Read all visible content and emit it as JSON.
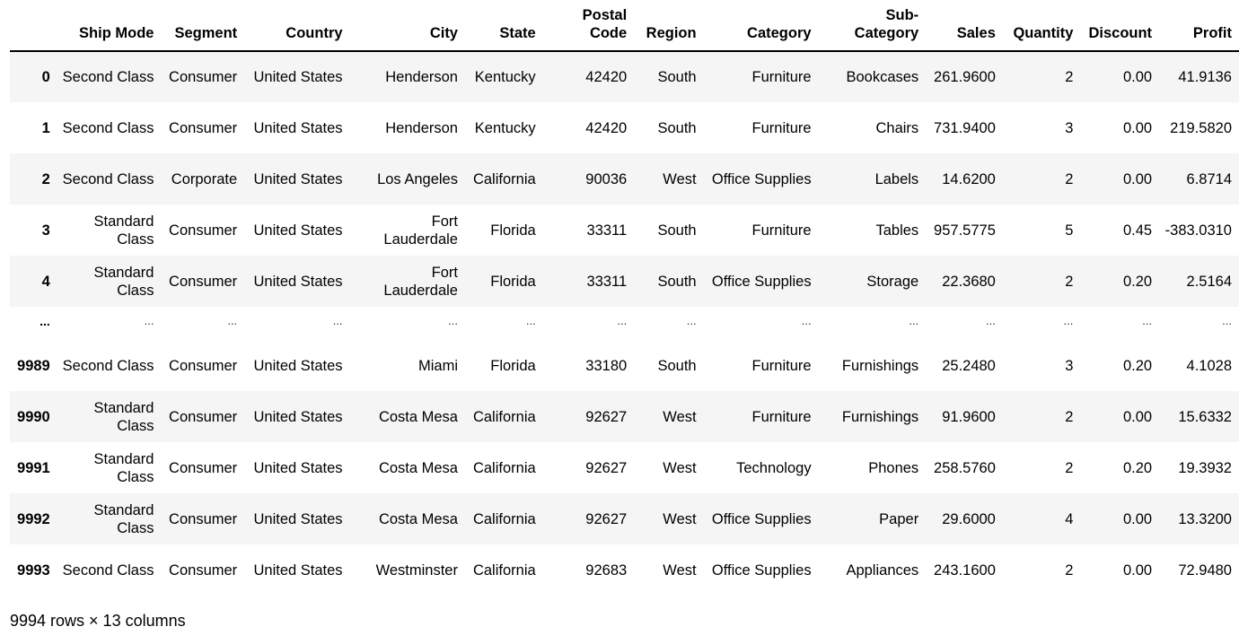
{
  "table": {
    "columns": [
      "",
      "Ship Mode",
      "Segment",
      "Country",
      "City",
      "State",
      "Postal Code",
      "Region",
      "Category",
      "Sub-Category",
      "Sales",
      "Quantity",
      "Discount",
      "Profit"
    ],
    "header_display": [
      "",
      "Ship Mode",
      "Segment",
      "Country",
      "City",
      "State",
      "Postal\nCode",
      "Region",
      "Category",
      "Sub-\nCategory",
      "Sales",
      "Quantity",
      "Discount",
      "Profit"
    ],
    "rows": [
      {
        "index": "0",
        "cells": [
          "Second Class",
          "Consumer",
          "United States",
          "Henderson",
          "Kentucky",
          "42420",
          "South",
          "Furniture",
          "Bookcases",
          "261.9600",
          "2",
          "0.00",
          "41.9136"
        ]
      },
      {
        "index": "1",
        "cells": [
          "Second Class",
          "Consumer",
          "United States",
          "Henderson",
          "Kentucky",
          "42420",
          "South",
          "Furniture",
          "Chairs",
          "731.9400",
          "3",
          "0.00",
          "219.5820"
        ]
      },
      {
        "index": "2",
        "cells": [
          "Second Class",
          "Corporate",
          "United States",
          "Los Angeles",
          "California",
          "90036",
          "West",
          "Office Supplies",
          "Labels",
          "14.6200",
          "2",
          "0.00",
          "6.8714"
        ]
      },
      {
        "index": "3",
        "cells": [
          "Standard Class",
          "Consumer",
          "United States",
          "Fort Lauderdale",
          "Florida",
          "33311",
          "South",
          "Furniture",
          "Tables",
          "957.5775",
          "5",
          "0.45",
          "-383.0310"
        ]
      },
      {
        "index": "4",
        "cells": [
          "Standard Class",
          "Consumer",
          "United States",
          "Fort Lauderdale",
          "Florida",
          "33311",
          "South",
          "Office Supplies",
          "Storage",
          "22.3680",
          "2",
          "0.20",
          "2.5164"
        ]
      },
      {
        "index": "...",
        "ellipsis": true,
        "cells": [
          "...",
          "...",
          "...",
          "...",
          "...",
          "...",
          "...",
          "...",
          "...",
          "...",
          "...",
          "...",
          "..."
        ]
      },
      {
        "index": "9989",
        "cells": [
          "Second Class",
          "Consumer",
          "United States",
          "Miami",
          "Florida",
          "33180",
          "South",
          "Furniture",
          "Furnishings",
          "25.2480",
          "3",
          "0.20",
          "4.1028"
        ]
      },
      {
        "index": "9990",
        "cells": [
          "Standard Class",
          "Consumer",
          "United States",
          "Costa Mesa",
          "California",
          "92627",
          "West",
          "Furniture",
          "Furnishings",
          "91.9600",
          "2",
          "0.00",
          "15.6332"
        ]
      },
      {
        "index": "9991",
        "cells": [
          "Standard Class",
          "Consumer",
          "United States",
          "Costa Mesa",
          "California",
          "92627",
          "West",
          "Technology",
          "Phones",
          "258.5760",
          "2",
          "0.20",
          "19.3932"
        ]
      },
      {
        "index": "9992",
        "cells": [
          "Standard Class",
          "Consumer",
          "United States",
          "Costa Mesa",
          "California",
          "92627",
          "West",
          "Office Supplies",
          "Paper",
          "29.6000",
          "4",
          "0.00",
          "13.3200"
        ]
      },
      {
        "index": "9993",
        "cells": [
          "Second Class",
          "Consumer",
          "United States",
          "Westminster",
          "California",
          "92683",
          "West",
          "Office Supplies",
          "Appliances",
          "243.1600",
          "2",
          "0.00",
          "72.9480"
        ]
      }
    ]
  },
  "footer": {
    "shape_text": "9994 rows × 13 columns"
  }
}
